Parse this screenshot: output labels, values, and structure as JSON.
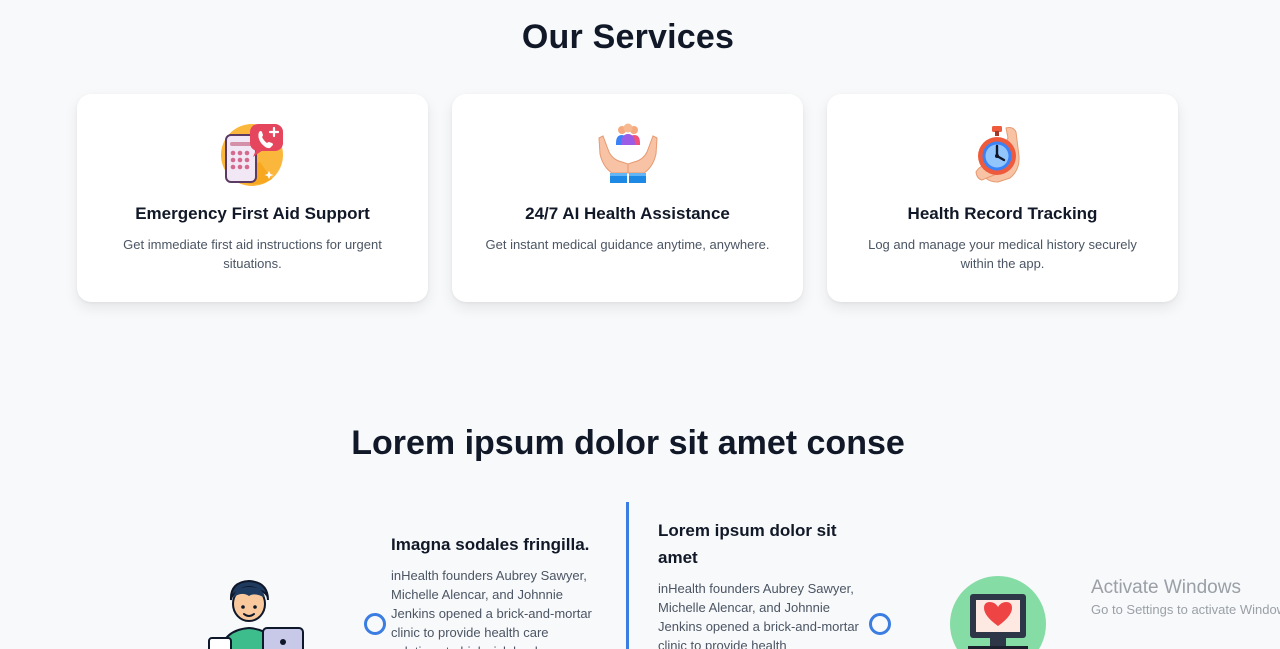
{
  "services": {
    "title": "Our Services",
    "cards": [
      {
        "title": "Emergency First Aid Support",
        "description": "Get immediate first aid instructions for urgent situations.",
        "icon": "emergency-phone-icon"
      },
      {
        "title": "24/7 AI Health Assistance",
        "description": "Get instant medical guidance anytime, anywhere.",
        "icon": "hands-people-care-icon"
      },
      {
        "title": "Health Record Tracking",
        "description": "Log and manage your medical history securely within the app.",
        "icon": "stopwatch-hand-icon"
      }
    ]
  },
  "timeline": {
    "title": "Lorem ipsum dolor sit amet conse",
    "items": [
      {
        "title": "Imagna sodales fringilla.",
        "description": "inHealth founders Aubrey Sawyer, Michelle Alencar, and Johnnie Jenkins opened a brick-and-mortar clinic to provide health care solutions to high-risk lands",
        "icon": "person-laptop-icon"
      },
      {
        "title": "Lorem ipsum dolor sit amet",
        "description": "inHealth founders Aubrey Sawyer, Michelle Alencar, and Johnnie Jenkins opened a brick-and-mortar clinic to provide health",
        "icon": "heart-monitor-icon"
      }
    ]
  },
  "watermark": {
    "title": "Activate Windows",
    "subtitle": "Go to Settings to activate Windows."
  },
  "colors": {
    "accent": "#3b7de1",
    "background": "#f8f9fb",
    "card": "#ffffff",
    "heading": "#111827",
    "body_text": "#4b5563"
  }
}
